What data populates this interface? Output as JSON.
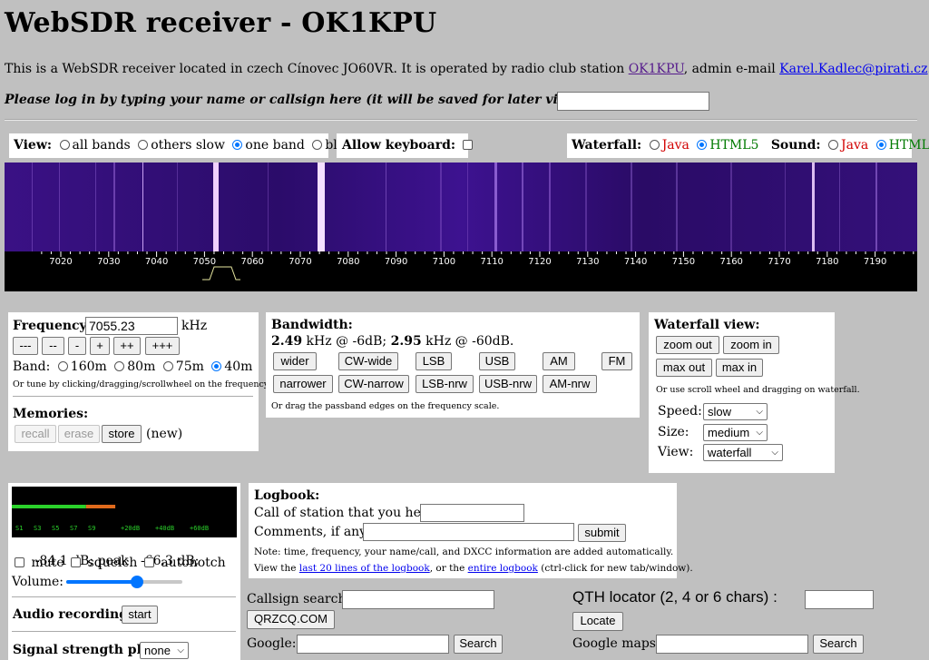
{
  "page": {
    "title": "WebSDR receiver - OK1KPU"
  },
  "intro": {
    "text_before": "This is a WebSDR receiver located in czech Cínovec JO60VR. It is operated by radio club station ",
    "station_link": "OK1KPU",
    "text_mid": ", admin e-mail ",
    "email_link": "Karel.Kadlec@pirati.cz",
    "text_after": "."
  },
  "login": {
    "prompt": "Please log in by typing your name or callsign here (it will be saved for later visits in a cookie):",
    "value": ""
  },
  "view_bar": {
    "label": "View:",
    "options": [
      "all bands",
      "others slow",
      "one band",
      "blind"
    ],
    "selected": "one band"
  },
  "keyboard": {
    "label": "Allow keyboard:",
    "checked": false
  },
  "waterfall_sound": {
    "waterfall_label": "Waterfall:",
    "sound_label": "Sound:",
    "java": "Java",
    "html5": "HTML5"
  },
  "scale": {
    "ticks": [
      "7020",
      "7030",
      "7040",
      "7050",
      "7060",
      "7070",
      "7080",
      "7090",
      "7100",
      "7110",
      "7120",
      "7130",
      "7140",
      "7150",
      "7160",
      "7170",
      "7180",
      "7190"
    ]
  },
  "frequency": {
    "label": "Frequency:",
    "value": "7055.23",
    "unit": "kHz",
    "step_buttons": [
      "---",
      "--",
      "-",
      "+",
      "++",
      "+++"
    ],
    "band_label": "Band:",
    "bands": [
      "160m",
      "80m",
      "75m",
      "40m"
    ],
    "band_selected": "40m",
    "hint": "Or tune by clicking/dragging/scrollwheel on the frequency scale."
  },
  "memories": {
    "label": "Memories:",
    "recall": "recall",
    "erase": "erase",
    "store": "store",
    "note": "(new)"
  },
  "bandwidth": {
    "label": "Bandwidth:",
    "bw1": "2.49",
    "bw1_rest": " kHz @ -6dB; ",
    "bw2": "2.95",
    "bw2_rest": " kHz @ -60dB.",
    "row1": [
      "wider",
      "CW-wide",
      "LSB",
      "USB",
      "AM",
      "FM"
    ],
    "row2": [
      "narrower",
      "CW-narrow",
      "LSB-nrw",
      "USB-nrw",
      "AM-nrw"
    ],
    "hint": "Or drag the passband edges on the frequency scale."
  },
  "waterfall_view": {
    "label": "Waterfall view:",
    "buttons": [
      "zoom out",
      "zoom in",
      "max out",
      "max in"
    ],
    "hint": "Or use scroll wheel and dragging on waterfall.",
    "speed_label": "Speed:",
    "speed_value": "slow",
    "size_label": "Size:",
    "size_value": "medium",
    "view_label": "View:",
    "view_value": "waterfall"
  },
  "smeter": {
    "scale_labels": [
      "S1",
      "S3",
      "S5",
      "S7",
      "S9",
      "+20dB",
      "+40dB",
      "+60dB"
    ],
    "readout": "-84.1 dB; peak   -66.3 dB;",
    "mute": "mute",
    "squelch": "squelch",
    "autonotch": "autonotch",
    "volume_label": "Volume:",
    "volume_level": 0.62,
    "level_fraction": 0.33,
    "peak_fraction": 0.46
  },
  "audio": {
    "label": "Audio recording:",
    "button": "start"
  },
  "signal_plot": {
    "label": "Signal strength plot:",
    "value": "none"
  },
  "logbook": {
    "label": "Logbook:",
    "call_label": "Call of station that you hear:",
    "comments_label": "Comments, if any:",
    "submit": "submit",
    "note": "Note: time, frequency, your name/call, and DXCC information are added automatically.",
    "view_before": "View the ",
    "link_last": "last 20 lines of the logbook",
    "view_mid": ", or the ",
    "link_entire": "entire logbook",
    "view_after": " (ctrl-click for new tab/window)."
  },
  "callsign": {
    "label": "Callsign search:",
    "qrz_button": "QRZCQ.COM",
    "google_label": "Google:",
    "search": "Search"
  },
  "qth": {
    "label": "QTH locator (2, 4 or 6 chars) :",
    "locate": "Locate",
    "maps_label": "Google maps:",
    "search": "Search"
  },
  "colors": {
    "background": "#c0c0c0",
    "waterfall_bg": "#2a0a5e",
    "link": "#0000ee",
    "visited_link": "#551a8b"
  }
}
